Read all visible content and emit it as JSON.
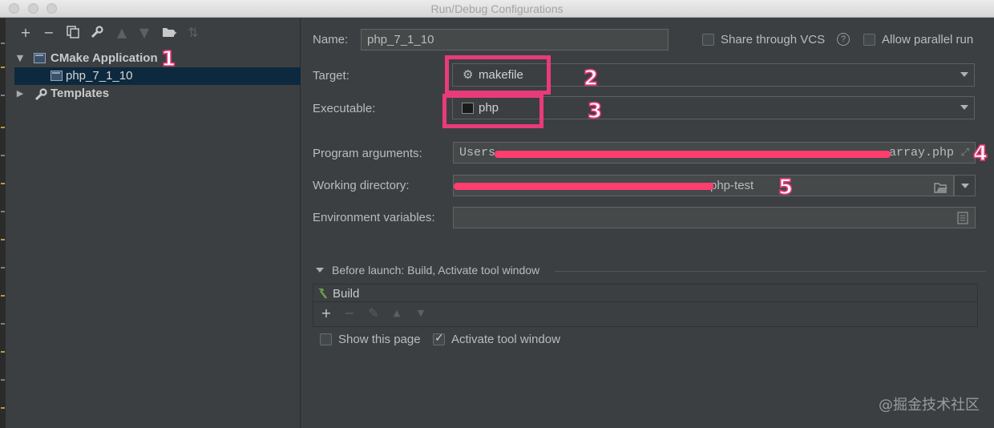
{
  "window": {
    "title": "Run/Debug Configurations"
  },
  "toolbar": {
    "icons": [
      "plus-icon",
      "minus-icon",
      "copy-icon",
      "wrench-icon",
      "arrow-up-icon",
      "arrow-down-icon",
      "folder-add-icon",
      "sort-icon"
    ]
  },
  "tree": {
    "group_label": "CMake Application",
    "config_label": "php_7_1_10",
    "templates_label": "Templates"
  },
  "form": {
    "name_label": "Name:",
    "name_value": "php_7_1_10",
    "share_label": "Share through VCS",
    "parallel_label": "Allow parallel run",
    "target_label": "Target:",
    "target_value": "makefile",
    "executable_label": "Executable:",
    "executable_value": "php",
    "args_label": "Program arguments:",
    "args_value_start": "Users",
    "args_value_end": "array.php",
    "workdir_label": "Working directory:",
    "workdir_value_end": "php-test",
    "env_label": "Environment variables:",
    "env_value": ""
  },
  "before_launch": {
    "header": "Before launch: Build, Activate tool window",
    "items": [
      "Build"
    ]
  },
  "footer": {
    "show_page_label": "Show this page",
    "show_page_checked": false,
    "activate_label": "Activate tool window",
    "activate_checked": true
  },
  "annotations": [
    "1",
    "2",
    "3",
    "4",
    "5"
  ],
  "watermark": "@掘金技术社区",
  "colors": {
    "highlight": "#e93b78",
    "selection": "#0d293e",
    "background": "#3c3f41"
  }
}
